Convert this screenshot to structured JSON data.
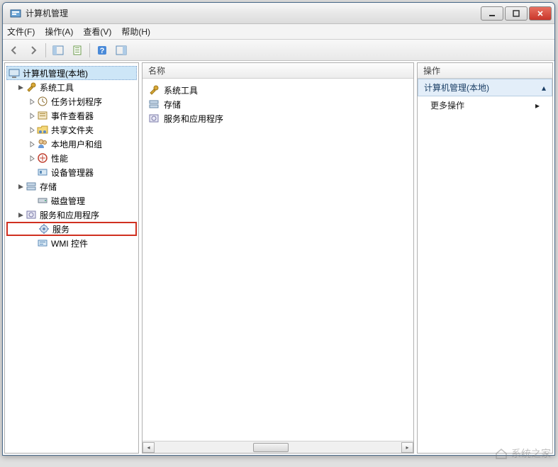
{
  "window": {
    "title": "计算机管理"
  },
  "menu": {
    "file": "文件(F)",
    "action": "操作(A)",
    "view": "查看(V)",
    "help": "帮助(H)"
  },
  "tree": {
    "root": "计算机管理(本地)",
    "sys_tools": "系统工具",
    "task_sched": "任务计划程序",
    "event_viewer": "事件查看器",
    "shared": "共享文件夹",
    "local_users": "本地用户和组",
    "perf": "性能",
    "dev_mgr": "设备管理器",
    "storage": "存储",
    "disk_mgmt": "磁盘管理",
    "services_apps": "服务和应用程序",
    "services": "服务",
    "wmi": "WMI 控件"
  },
  "list": {
    "header": "名称",
    "item1": "系统工具",
    "item2": "存储",
    "item3": "服务和应用程序"
  },
  "actions": {
    "header": "操作",
    "section": "计算机管理(本地)",
    "more": "更多操作"
  },
  "watermark": "系统之家"
}
